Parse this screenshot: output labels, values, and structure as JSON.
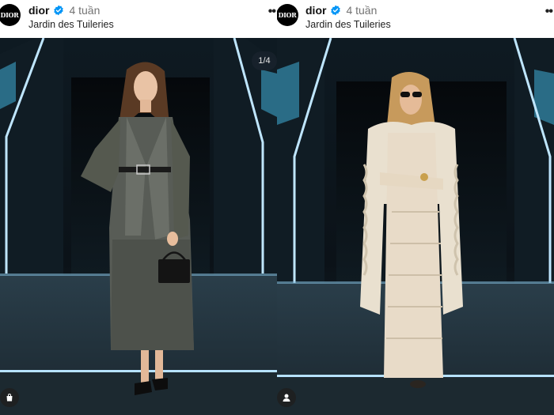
{
  "posts": [
    {
      "account": "dior",
      "avatar_text": "DIOR",
      "time_ago": "4 tuần",
      "location": "Jardin des Tuileries",
      "more_icon": "more-icon",
      "carousel_counter": "1/4",
      "badge_icon": "shopping-bag-icon"
    },
    {
      "account": "dior",
      "avatar_text": "DIOR",
      "time_ago": "4 tuần",
      "location": "Jardin des Tuileries",
      "more_icon": "more-icon",
      "badge_icon": "user-tag-icon"
    }
  ],
  "colors": {
    "verified_blue": "#0095f6",
    "neon_light": "#9fd8ff",
    "backdrop": "#0a1118"
  }
}
